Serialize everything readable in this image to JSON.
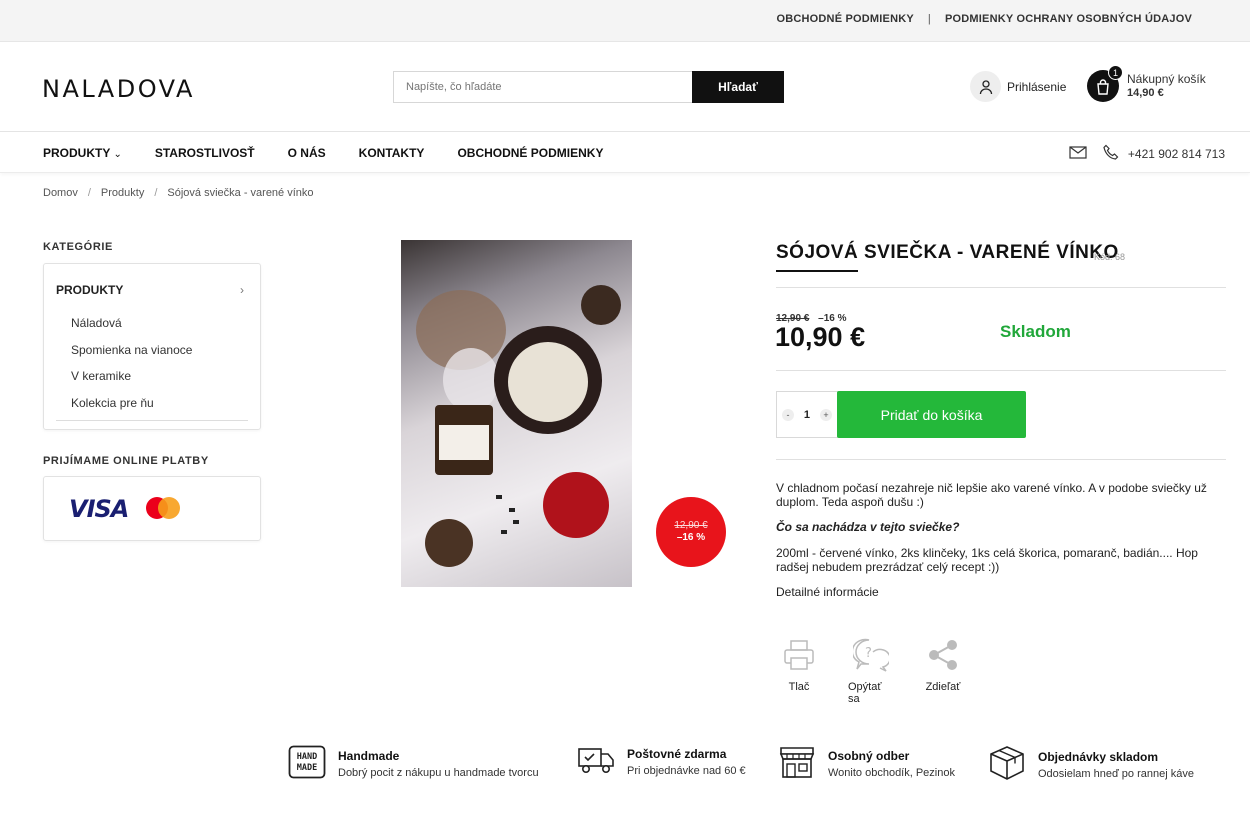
{
  "topbar": {
    "link1": "OBCHODNÉ PODMIENKY",
    "sep": "|",
    "link2": "PODMIENKY OCHRANY OSOBNÝCH ÚDAJOV"
  },
  "header": {
    "logo": "NALADOVA",
    "search_placeholder": "Napíšte, čo hľadáte",
    "search_button": "Hľadať",
    "login": "Prihlásenie",
    "cart_label": "Nákupný košík",
    "cart_total": "14,90 €",
    "cart_count": "1"
  },
  "nav": {
    "items": [
      "PRODUKTY",
      "STAROSTLIVOSŤ",
      "O NÁS",
      "KONTAKTY",
      "OBCHODNÉ PODMIENKY"
    ],
    "phone": "+421 902 814 713"
  },
  "breadcrumb": {
    "items": [
      "Domov",
      "Produkty",
      "Sójová sviečka - varené vínko"
    ],
    "sep": "/"
  },
  "sidebar": {
    "categories_title": "KATEGÓRIE",
    "main": "PRODUKTY",
    "sub": [
      "Náladová",
      "Spomienka na vianoce",
      "V keramike",
      "Kolekcia pre ňu"
    ],
    "payments_title": "PRIJÍMAME ONLINE PLATBY",
    "visa": "VISA"
  },
  "product": {
    "title": "SÓJOVÁ SVIEČKA - VARENÉ VÍNKO",
    "code": "Kód: 68",
    "old_price": "12,90 €",
    "discount": "–16 %",
    "price": "10,90 €",
    "stock": "Skladom",
    "qty": "1",
    "qty_minus": "-",
    "qty_plus": "+",
    "add_button": "Pridať do košíka",
    "badge_old": "12,90 €",
    "badge_pct": "–16 %",
    "desc1": "V chladnom počasí nezahreje nič lepšie ako varené vínko. A v podobe sviečky už duplom. Teda aspoň dušu :)",
    "desc2": "Čo sa nachádza v tejto sviečke?",
    "desc3": "200ml - červené vínko, 2ks klinčeky, 1ks celá škorica, pomaranč, badián.... Hop radšej nebudem prezrádzať celý recept :))",
    "details": "Detailné informácie",
    "actions": [
      "Tlač",
      "Opýtať sa",
      "Zdieľať"
    ]
  },
  "features": [
    {
      "title": "Handmade",
      "text": "Dobrý pocit z nákupu u handmade tvorcu",
      "icon": "handmade-icon",
      "icon_text": "HAND MADE"
    },
    {
      "title": "Poštovné zdarma",
      "text": "Pri objednávke nad 60 €",
      "icon": "delivery-truck-icon"
    },
    {
      "title": "Osobný odber",
      "text": "Wonito obchodík, Pezinok",
      "icon": "shop-icon"
    },
    {
      "title": "Objednávky skladom",
      "text": "Odosielam hneď po rannej káve",
      "icon": "box-icon"
    }
  ],
  "colors": {
    "accent_green": "#24b83a",
    "stock_green": "#21a73a",
    "sale_red": "#e8141b"
  }
}
